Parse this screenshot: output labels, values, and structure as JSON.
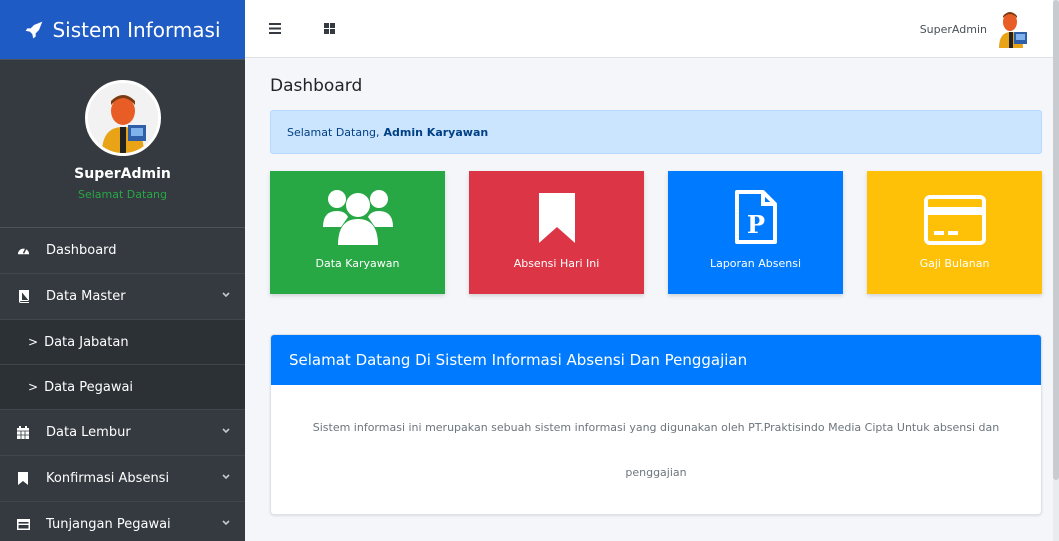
{
  "brand": {
    "title": "Sistem Informasi"
  },
  "user_panel": {
    "name": "SuperAdmin",
    "subtitle": "Selamat Datang"
  },
  "sidebar": {
    "items": [
      {
        "label": "Dashboard",
        "icon": "dashboard-icon"
      },
      {
        "label": "Data Master",
        "icon": "book-icon"
      },
      {
        "label": "Data Jabatan",
        "prefix": ">"
      },
      {
        "label": "Data Pegawai",
        "prefix": ">"
      },
      {
        "label": "Data Lembur",
        "icon": "calendar-icon"
      },
      {
        "label": "Konfirmasi Absensi",
        "icon": "bookmark-icon"
      },
      {
        "label": "Tunjangan Pegawai",
        "icon": "credit-card-icon"
      }
    ]
  },
  "topbar": {
    "username": "SuperAdmin"
  },
  "content": {
    "title": "Dashboard",
    "welcome_text": "Selamat Datang,",
    "welcome_name": "Admin Karyawan",
    "boxes": [
      {
        "label": "Data Karyawan",
        "color": "#28a745",
        "icon": "users-icon"
      },
      {
        "label": "Absensi Hari Ini",
        "color": "#dc3545",
        "icon": "bookmark-icon"
      },
      {
        "label": "Laporan Absensi",
        "color": "#007bff",
        "icon": "file-p-icon"
      },
      {
        "label": "Gaji Bulanan",
        "color": "#ffc107",
        "icon": "credit-card-icon"
      }
    ],
    "card": {
      "header": "Selamat Datang Di Sistem Informasi Absensi Dan Penggajian",
      "body": "Sistem informasi ini merupakan sebuah sistem informasi yang digunakan oleh PT.Praktisindo Media Cipta Untuk absensi dan penggajian"
    }
  },
  "colors": {
    "sidebar": "#343a40",
    "brand": "#1f5bc4",
    "primary": "#007bff"
  }
}
